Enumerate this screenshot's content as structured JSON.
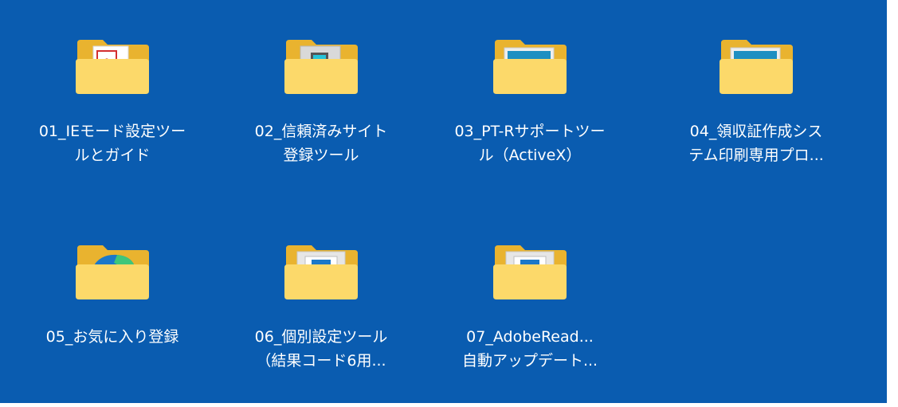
{
  "desktop": {
    "items": [
      {
        "label": "01_IEモード設定ツー\nルとガイド",
        "icon": "folder-pdf-icon"
      },
      {
        "label": "02_信頼済みサイト\n登録ツール",
        "icon": "folder-program-icon"
      },
      {
        "label": "03_PT-Rサポートツー\nル（ActiveX）",
        "icon": "folder-image-icon"
      },
      {
        "label": "04_領収証作成シス\nテム印刷専用プロ...",
        "icon": "folder-image-icon"
      },
      {
        "label": "05_お気に入り登録",
        "icon": "folder-edge-icon"
      },
      {
        "label": "06_個別設定ツール\n（結果コード6用...",
        "icon": "folder-window-icon"
      },
      {
        "label": "07_AdobeRead...\n自動アップデート...",
        "icon": "folder-window-icon"
      }
    ]
  },
  "colors": {
    "background": "#0a5cb0",
    "folder_back": "#f5c443",
    "folder_front": "#fcd96a"
  }
}
